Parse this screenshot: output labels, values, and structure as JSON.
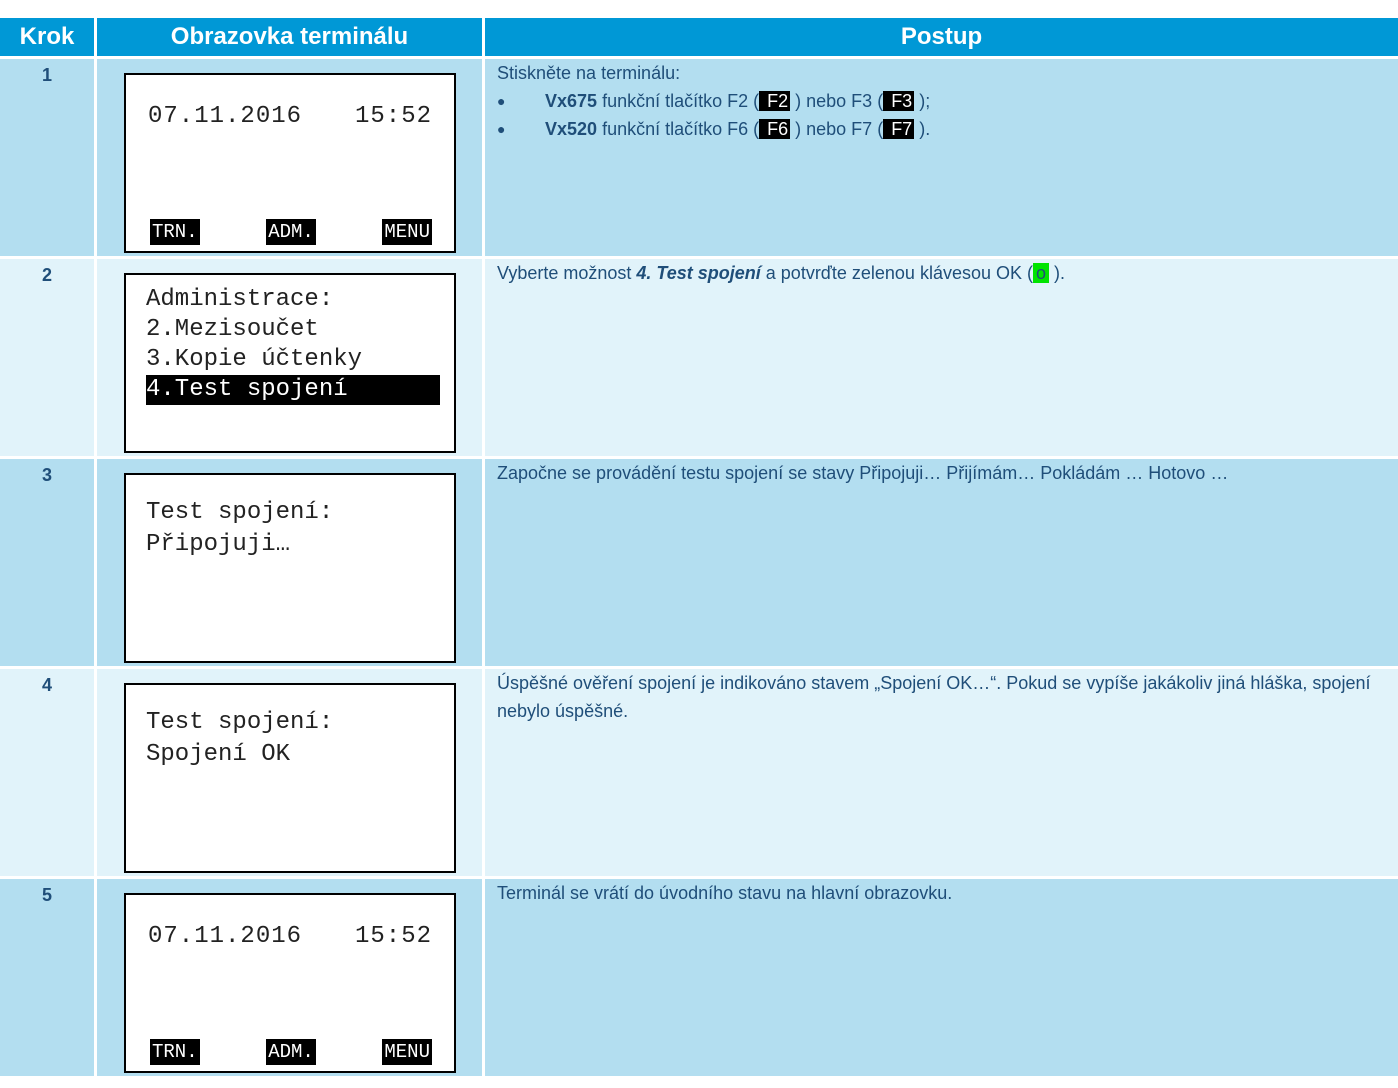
{
  "header": {
    "col_step": "Krok",
    "col_screen": "Obrazovka terminálu",
    "col_procedure": "Postup"
  },
  "colors": {
    "header_bg": "#0098d6",
    "row_dark": "#b3def0",
    "row_light": "#e1f3fa",
    "text": "#1f4e79",
    "ok_key": "#00e400"
  },
  "rows": [
    {
      "step": "1",
      "screen": {
        "date": "07.11.2016",
        "time": "15:52",
        "softkeys": [
          "TRN.",
          "ADM.",
          "MENU"
        ]
      },
      "procedure": {
        "intro": "Stiskněte na terminálu:",
        "bullets": [
          {
            "model": "Vx675",
            "t1": " funkční tlačítko F2 (",
            "k1": "F2",
            "t2": " ) nebo F3 (",
            "k2": "F3",
            "t3": " );"
          },
          {
            "model": "Vx520",
            "t1": " funkční tlačítko F6 (",
            "k1": "F6",
            "t2": " ) nebo F7 (",
            "k2": "F7",
            "t3": " )."
          }
        ]
      }
    },
    {
      "step": "2",
      "screen": {
        "lines": [
          "Administrace:",
          "2.Mezisoučet",
          "3.Kopie účtenky",
          "4.Test spojení"
        ]
      },
      "procedure": {
        "t1": "Vyberte možnost ",
        "bold": "4. Test spojení",
        "t2": " a potvrďte zelenou klávesou OK (",
        "key": "o",
        "t3": " )."
      }
    },
    {
      "step": "3",
      "screen": {
        "lines": [
          "Test spojení:",
          "Připojuji…"
        ]
      },
      "procedure": {
        "text": "Započne se provádění testu spojení se stavy Připojuji… Přijímám… Pokládám … Hotovo …"
      }
    },
    {
      "step": "4",
      "screen": {
        "lines": [
          "Test spojení:",
          "Spojení OK"
        ]
      },
      "procedure": {
        "text": "Úspěšné ověření spojení je indikováno stavem „Spojení OK…“. Pokud se vypíše jakákoliv jiná hláška, spojení nebylo úspěšné."
      }
    },
    {
      "step": "5",
      "screen": {
        "date": "07.11.2016",
        "time": "15:52",
        "softkeys": [
          "TRN.",
          "ADM.",
          "MENU"
        ]
      },
      "procedure": {
        "text": "Terminál se vrátí do úvodního stavu na hlavní obrazovku."
      }
    }
  ]
}
